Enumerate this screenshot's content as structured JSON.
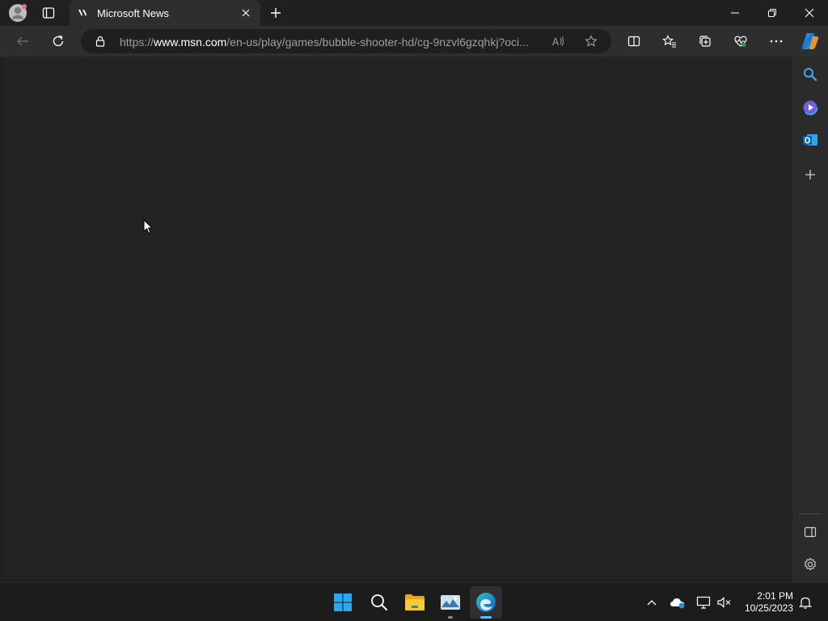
{
  "browser": {
    "tab": {
      "title": "Microsoft News"
    },
    "url": {
      "prefix": "https://",
      "domain": "www.msn.com",
      "path": "/en-us/play/games/bubble-shooter-hd/cg-9nzvl6gzqhkj?oci..."
    }
  },
  "taskbar": {
    "time": "2:01 PM",
    "date": "10/25/2023"
  },
  "colors": {
    "background": "#202020",
    "toolbar": "#2e2e2e",
    "content": "#232323",
    "accent_edge": "#1e90d8",
    "windows_logo": "#29a8f0"
  },
  "icons": {
    "profile": "profile-avatar-icon",
    "tab_actions": "tab-actions-icon",
    "new_tab": "plus-icon",
    "back": "back-arrow-icon",
    "refresh": "refresh-icon",
    "lock": "lock-icon",
    "read_aloud": "read-aloud-icon",
    "favorite": "star-icon",
    "split_screen": "split-screen-icon",
    "favorites": "favorites-icon",
    "collections": "collections-icon",
    "performance": "heartbeat-icon",
    "more": "more-icon",
    "copilot": "copilot-icon"
  }
}
